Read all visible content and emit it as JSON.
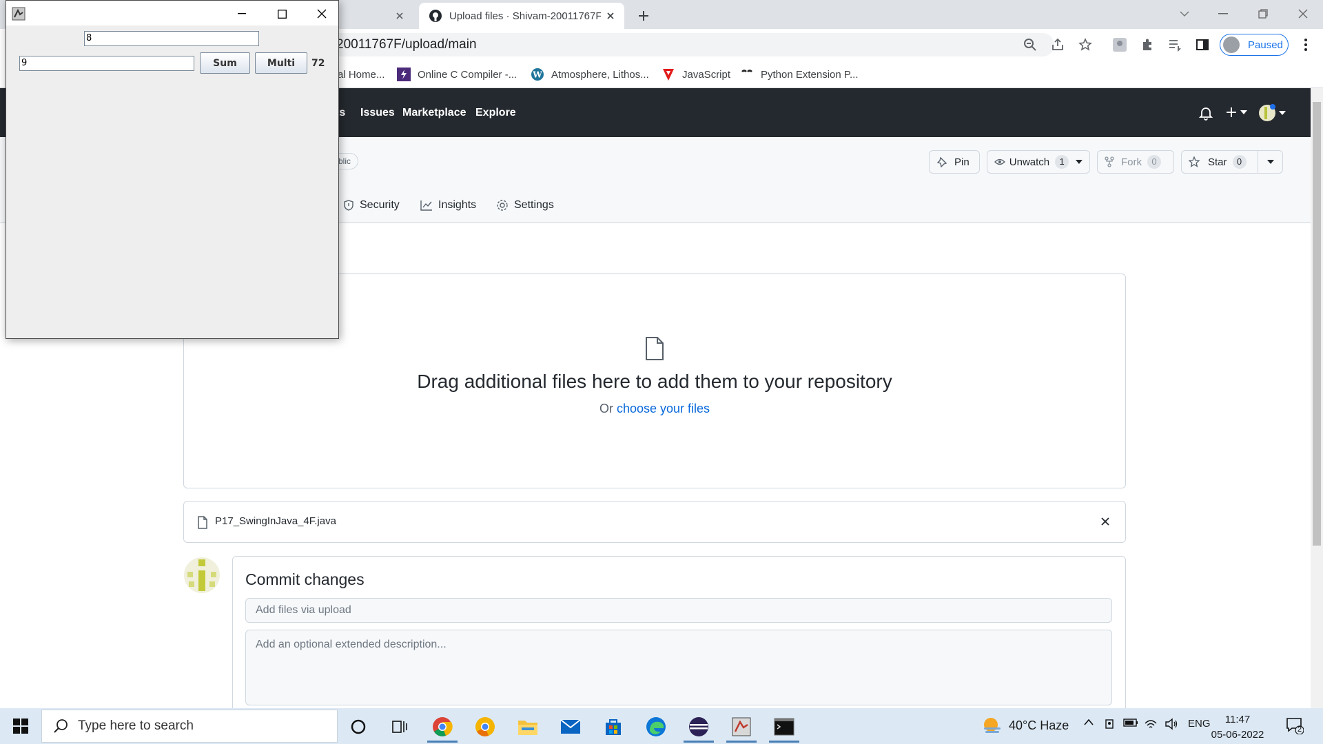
{
  "browser": {
    "tabs": [
      {
        "label": ""
      },
      {
        "label": "Upload files · Shivam-20011767F"
      }
    ],
    "address": "20011767F/upload/main",
    "profile_label": "Paused",
    "bookmarks": [
      {
        "label": "al Home...",
        "icon": "bookmark-icon"
      },
      {
        "label": "Online C Compiler -...",
        "icon": "lightning-icon"
      },
      {
        "label": "Atmosphere, Lithos...",
        "icon": "wordpress-icon"
      },
      {
        "label": "JavaScript",
        "icon": "javascript-icon"
      },
      {
        "label": "Python Extension P...",
        "icon": "python-icon"
      }
    ]
  },
  "github": {
    "nav": [
      "ts",
      "Issues",
      "Marketplace",
      "Explore"
    ],
    "visibility_badge": "blic",
    "repo_actions": {
      "pin": "Pin",
      "unwatch": "Unwatch",
      "unwatch_count": "1",
      "fork": "Fork",
      "fork_count": "0",
      "star": "Star",
      "star_count": "0"
    },
    "repo_tabs": [
      "Security",
      "Insights",
      "Settings"
    ],
    "dropzone": {
      "title": "Drag additional files here to add them to your repository",
      "prefix": "Or ",
      "link": "choose your files"
    },
    "file": {
      "name": "P17_SwingInJava_4F.java"
    },
    "commit": {
      "title": "Commit changes",
      "summary_placeholder": "Add files via upload",
      "description_placeholder": "Add an optional extended description..."
    }
  },
  "swing_app": {
    "field1": "8",
    "field2": "9",
    "sum_button": "Sum",
    "multi_button": "Multi",
    "result": "72"
  },
  "taskbar": {
    "search_placeholder": "Type here to search",
    "weather": "40°C  Haze",
    "language": "ENG",
    "time": "11:47",
    "date": "05-06-2022",
    "notification_count": "2"
  },
  "colors": {
    "github_header": "#24292f",
    "link": "#0969da",
    "taskbar": "#dce9f5"
  }
}
